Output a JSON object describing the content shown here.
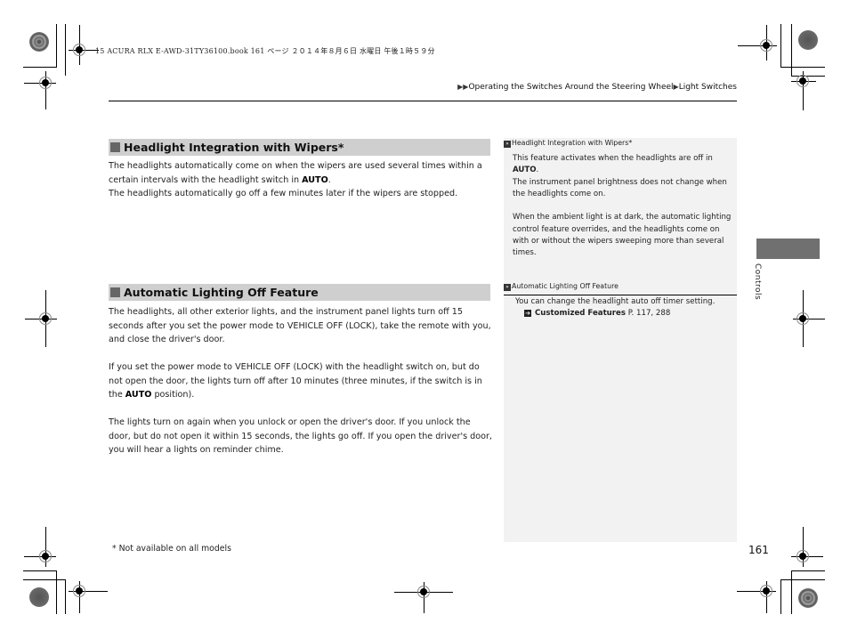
{
  "print_header": "15 ACURA RLX E-AWD-31TY36100.book  161 ページ  ２０１４年８月６日  水曜日  午後１時５９分",
  "breadcrumb": {
    "prefix_icon": "double-triangle-icon",
    "section": "Operating the Switches Around the Steering Wheel",
    "separator_icon": "triangle-icon",
    "page": "Light Switches"
  },
  "main": {
    "sections": [
      {
        "title": "Headlight Integration with Wipers",
        "title_suffix": "*",
        "paragraphs": [
          {
            "before": "The headlights automatically come on when the wipers are used several times within a certain intervals with the headlight switch in ",
            "bold": "AUTO",
            "after": "."
          },
          {
            "text": "The headlights automatically go off a few minutes later if the wipers are stopped."
          }
        ]
      },
      {
        "title": "Automatic Lighting Off Feature",
        "paragraphs": [
          {
            "text": "The headlights, all other exterior lights, and the instrument panel lights turn off 15 seconds after you set the power mode to VEHICLE OFF (LOCK), take the remote with you, and close the driver's door."
          },
          {
            "before": "If you set the power mode to VEHICLE OFF (LOCK) with the headlight switch on, but do not open the door, the lights turn off after 10 minutes (three minutes, if the switch is in the ",
            "bold": "AUTO",
            "after": " position)."
          },
          {
            "text": "The lights turn on again when you unlock or open the driver's door. If you unlock the door, but do not open it within 15 seconds, the lights go off. If you open the driver's door, you will hear a lights on reminder chime."
          }
        ]
      }
    ]
  },
  "sidebar": {
    "notes": [
      {
        "heading": "Headlight Integration with Wipers",
        "heading_suffix": "*",
        "p1_before": "This feature activates when the headlights are off in ",
        "p1_bold": "AUTO",
        "p1_after": ".",
        "p2": "The instrument panel brightness does not change when the headlights come on.",
        "p3": "When the ambient light is at dark, the automatic lighting control feature overrides, and the headlights come on with or without the wipers sweeping more than several times."
      },
      {
        "heading": "Automatic Lighting Off Feature",
        "p1": "You can change the headlight auto off timer setting.",
        "xref_label": "Customized Features",
        "xref_pages": "P. 117, 288"
      }
    ]
  },
  "chapter_tab": {
    "label": "Controls",
    "color": "#707070"
  },
  "footnote": "* Not available on all models",
  "page_number": "161"
}
